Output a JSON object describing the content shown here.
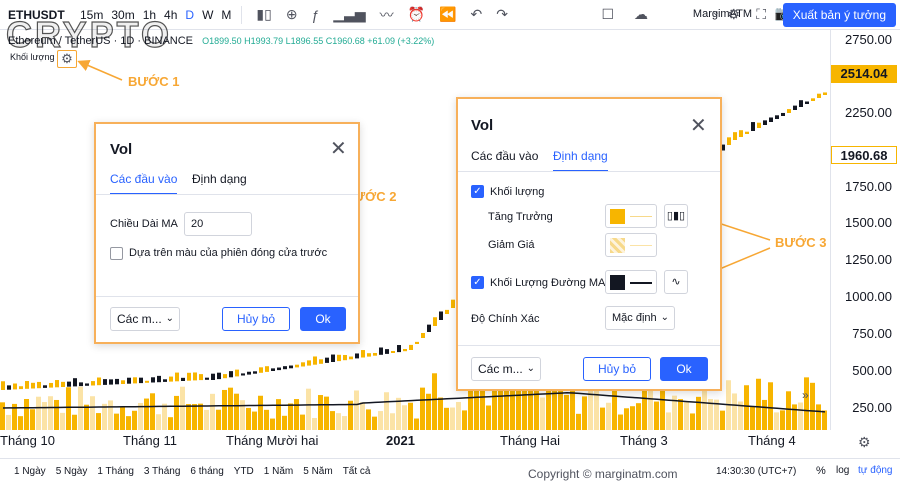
{
  "toolbar": {
    "symbol": "ETHUSDT",
    "timeframes": [
      "15m",
      "30m",
      "1h",
      "4h",
      "D",
      "W",
      "M"
    ],
    "active_timeframe": "D",
    "template_label": "MargimATM",
    "publish_label": "Xuất bản ý tưởng"
  },
  "watermark": "CRYPTO",
  "legend": {
    "title": "Ethereum / TetherUS · 1D · BINANCE",
    "ohlc": "O1899.50 H1993.79 L1896.55 C1960.68 +61.09 (+3.22%)",
    "volume_label": "Khối lượng"
  },
  "steps": {
    "step1": "BƯỚC 1",
    "step2": "BƯỚC 2",
    "step3": "BƯỚC 3"
  },
  "price_axis": {
    "labels": [
      "2750.00",
      "2250.00",
      "1750.00",
      "1500.00",
      "1250.00",
      "1000.00",
      "750.00",
      "500.00",
      "250.00"
    ],
    "last_price": "2514.04",
    "current_price": "1960.68"
  },
  "time_axis": [
    "Tháng 10",
    "Tháng 11",
    "Tháng Mười hai",
    "2021",
    "Tháng Hai",
    "Tháng 3",
    "Tháng 4"
  ],
  "footer": {
    "ranges": [
      "1 Ngày",
      "5 Ngày",
      "1 Tháng",
      "3 Tháng",
      "6 tháng",
      "YTD",
      "1 Năm",
      "5 Năm",
      "Tất cả"
    ],
    "copyright": "Copyright © marginatm.com",
    "clock": "14:30:30 (UTC+7)",
    "percent": "%",
    "log": "log",
    "auto": "tự động"
  },
  "dialog_inputs": {
    "title": "Vol",
    "tab_inputs": "Các đầu vào",
    "tab_style": "Định dạng",
    "ma_length_label": "Chiều Dài MA",
    "ma_length_value": "20",
    "color_prev_close_label": "Dựa trên màu của phiên đóng cửa trước",
    "defaults_label": "Các m...",
    "cancel_label": "Hủy bỏ",
    "ok_label": "Ok"
  },
  "dialog_style": {
    "title": "Vol",
    "tab_inputs": "Các đầu vào",
    "tab_style": "Định dạng",
    "volume_label": "Khối lượng",
    "growing_label": "Tăng Trưởng",
    "falling_label": "Giảm Giá",
    "volume_ma_label": "Khối Lượng Đường MA",
    "precision_label": "Độ Chính Xác",
    "precision_value": "Mặc định",
    "defaults_label": "Các m...",
    "cancel_label": "Hủy bỏ",
    "ok_label": "Ok"
  },
  "colors": {
    "accent": "#2962ff",
    "step_orange": "#f7a734",
    "volume_up": "#f7b500",
    "volume_down": "#fbe3a6",
    "candle_up": "#f7b500",
    "candle_down": "#131722"
  }
}
